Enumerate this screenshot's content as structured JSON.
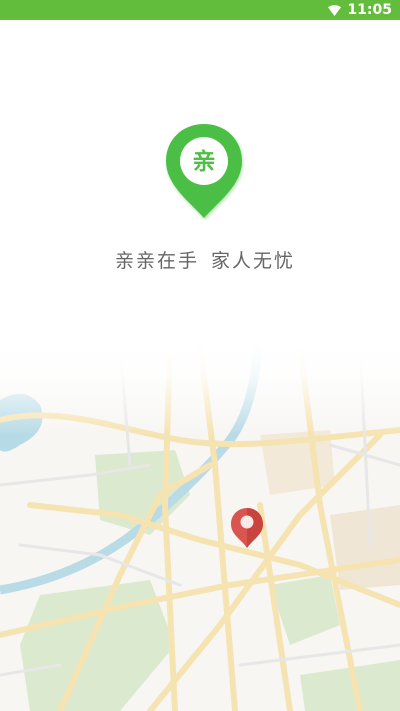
{
  "status_bar": {
    "time": "11:05",
    "icons": [
      "wifi-icon"
    ],
    "color": "#62bd3c"
  },
  "logo": {
    "character": "亲",
    "icon": "map-pin-logo-icon",
    "color": "#4cbf45"
  },
  "slogan": {
    "part1": "亲亲在手",
    "part2": "家人无忧"
  },
  "map": {
    "icon": "map-illustration",
    "marker_icon": "location-pin-icon",
    "marker_color": "#d95550"
  }
}
